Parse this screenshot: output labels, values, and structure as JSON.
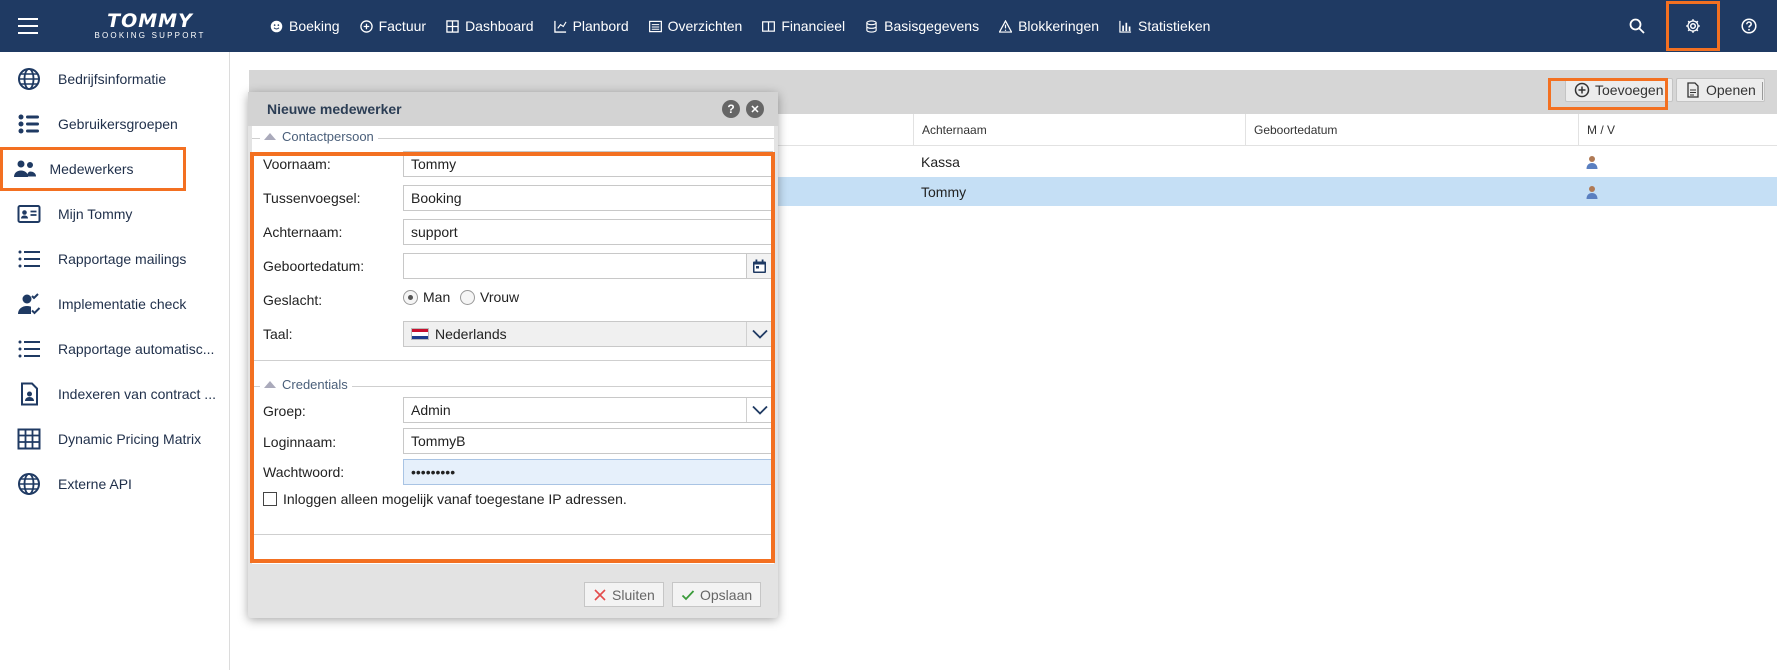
{
  "brand": {
    "name": "TOMMY",
    "tagline": "BOOKING SUPPORT"
  },
  "nav": [
    {
      "label": "Boeking",
      "icon": "smile-icon"
    },
    {
      "label": "Factuur",
      "icon": "plus-circle-icon"
    },
    {
      "label": "Dashboard",
      "icon": "grid-icon"
    },
    {
      "label": "Planbord",
      "icon": "chart-icon"
    },
    {
      "label": "Overzichten",
      "icon": "list-window-icon"
    },
    {
      "label": "Financieel",
      "icon": "book-icon"
    },
    {
      "label": "Basisgegevens",
      "icon": "database-icon"
    },
    {
      "label": "Blokkeringen",
      "icon": "warning-icon"
    },
    {
      "label": "Statistieken",
      "icon": "bar-chart-icon"
    }
  ],
  "sidebar": {
    "items": [
      {
        "label": "Bedrijfsinformatie",
        "icon": "globe-icon"
      },
      {
        "label": "Gebruikersgroepen",
        "icon": "user-groups-icon"
      },
      {
        "label": "Medewerkers",
        "icon": "people-icon",
        "active": true
      },
      {
        "label": "Mijn Tommy",
        "icon": "id-card-icon"
      },
      {
        "label": "Rapportage mailings",
        "icon": "list-icon"
      },
      {
        "label": "Implementatie check",
        "icon": "user-check-icon"
      },
      {
        "label": "Rapportage automatisc...",
        "icon": "list-icon"
      },
      {
        "label": "Indexeren van contract ...",
        "icon": "document-user-icon"
      },
      {
        "label": "Dynamic Pricing Matrix",
        "icon": "table-icon"
      },
      {
        "label": "Externe API",
        "icon": "globe-icon"
      }
    ]
  },
  "toolbar": {
    "add_label": "Toevoegen",
    "open_label": "Openen"
  },
  "grid": {
    "columns": [
      "Achternaam",
      "Geboortedatum",
      "M / V"
    ],
    "rows": [
      {
        "achternaam": "Kassa",
        "geboortedatum": "",
        "selected": false
      },
      {
        "achternaam": "Tommy",
        "geboortedatum": "",
        "selected": true
      }
    ]
  },
  "dialog": {
    "title": "Nieuwe medewerker",
    "help": "?",
    "close": "✕",
    "contact_section": "Contactpersoon",
    "credentials_section": "Credentials",
    "fields": {
      "voornaam": {
        "label": "Voornaam:",
        "value": "Tommy"
      },
      "tussenvoegsel": {
        "label": "Tussenvoegsel:",
        "value": "Booking"
      },
      "achternaam": {
        "label": "Achternaam:",
        "value": "support"
      },
      "geboortedatum": {
        "label": "Geboortedatum:",
        "value": ""
      },
      "geslacht": {
        "label": "Geslacht:",
        "options": [
          "Man",
          "Vrouw"
        ],
        "selected": "Man"
      },
      "taal": {
        "label": "Taal:",
        "value": "Nederlands"
      },
      "groep": {
        "label": "Groep:",
        "value": "Admin"
      },
      "loginnaam": {
        "label": "Loginnaam:",
        "value": "TommyB"
      },
      "wachtwoord": {
        "label": "Wachtwoord:",
        "value": "•••••••••"
      }
    },
    "ip_checkbox_label": "Inloggen alleen mogelijk vanaf toegestane IP adressen.",
    "close_button": "Sluiten",
    "save_button": "Opslaan"
  },
  "colors": {
    "nav_bg": "#1f3a63",
    "highlight": "#f37021",
    "selected_row": "#c5dff5"
  }
}
